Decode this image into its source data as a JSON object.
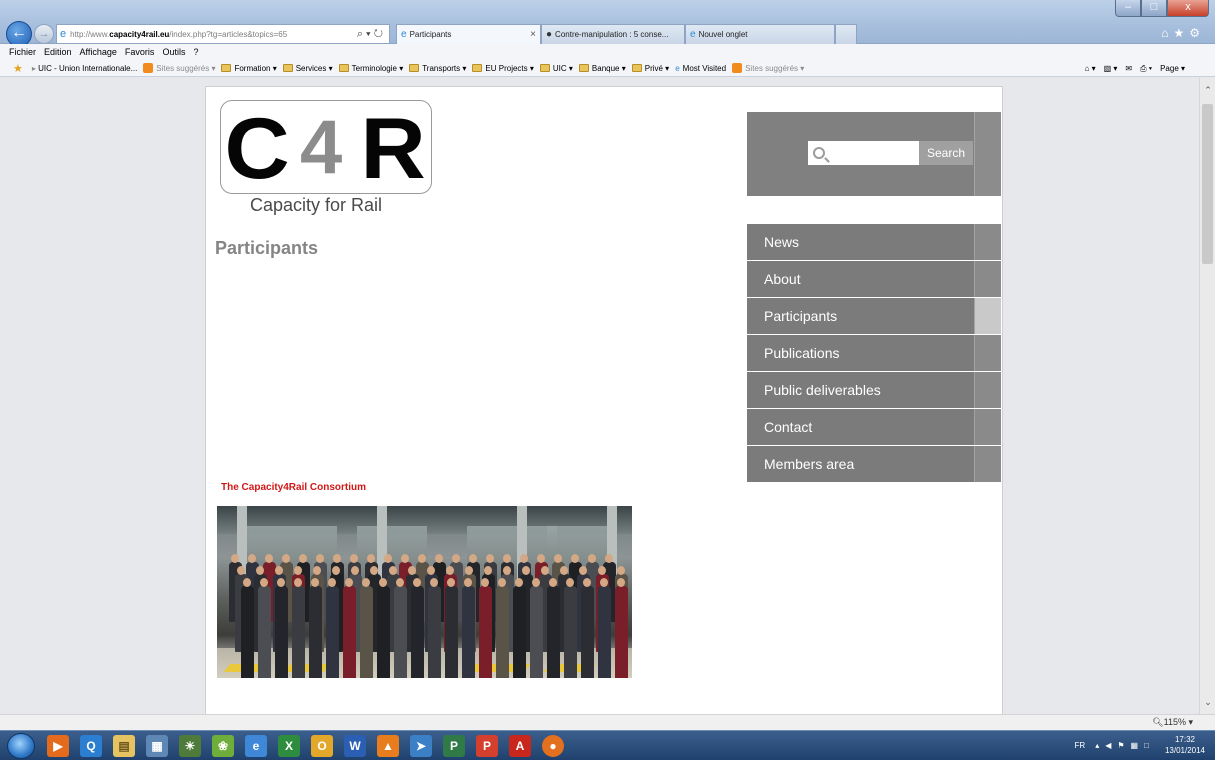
{
  "browser": {
    "url_prefix": "http://www.",
    "url_host": "capacity4rail.eu",
    "url_path": "/index.php?tg=articles&topics=65",
    "addr_tools": "⌕ ▾ ↻",
    "tabs": [
      {
        "title": "Participants",
        "close": "×"
      },
      {
        "title": "Contre-manipulation : 5 conse..."
      },
      {
        "title": "Nouvel onglet"
      }
    ],
    "window_controls": {
      "minimize": "–",
      "maximize": "□",
      "close": "x"
    },
    "right_icons": "⌂★⚙"
  },
  "menubar": [
    "Fichier",
    "Edition",
    "Affichage",
    "Favoris",
    "Outils",
    "?"
  ],
  "favorites": [
    {
      "label": "UIC - Union Internationale...",
      "type": "link"
    },
    {
      "label": "Sites suggérés ▾",
      "type": "suggested"
    },
    {
      "label": "Formation ▾",
      "type": "folder"
    },
    {
      "label": "Services ▾",
      "type": "folder"
    },
    {
      "label": "Terminologie ▾",
      "type": "folder"
    },
    {
      "label": "Transports ▾",
      "type": "folder"
    },
    {
      "label": "EU Projects ▾",
      "type": "folder"
    },
    {
      "label": "UIC ▾",
      "type": "folder"
    },
    {
      "label": "Banque ▾",
      "type": "folder"
    },
    {
      "label": "Privé ▾",
      "type": "folder"
    },
    {
      "label": "Most Visited",
      "type": "link"
    },
    {
      "label": "Sites suggérés ▾",
      "type": "suggested"
    }
  ],
  "command_bar": {
    "home": "⌂ ▾",
    "feeds": "▧ ▾",
    "mail": "✉",
    "print": "⎙ ▾",
    "page": "Page ▾"
  },
  "site": {
    "logo": {
      "c": "C",
      "four": "4",
      "r": "R",
      "tagline": "Capacity for Rail"
    },
    "page_title": "Participants",
    "search": {
      "placeholder": "",
      "button": "Search"
    },
    "nav": [
      "News",
      "About",
      "Participants",
      "Publications",
      "Public deliverables",
      "Contact",
      "Members area"
    ],
    "active_nav": "Participants",
    "consortium_caption": "The Capacity4Rail Consortium"
  },
  "status": {
    "zoom": "115%"
  },
  "taskbar": {
    "lang": "FR",
    "time": "17:32",
    "date": "13/01/2014"
  },
  "colors": {
    "nav_bg": "#7b7b7b",
    "caption_red": "#d01818",
    "title_grey": "#858585"
  }
}
